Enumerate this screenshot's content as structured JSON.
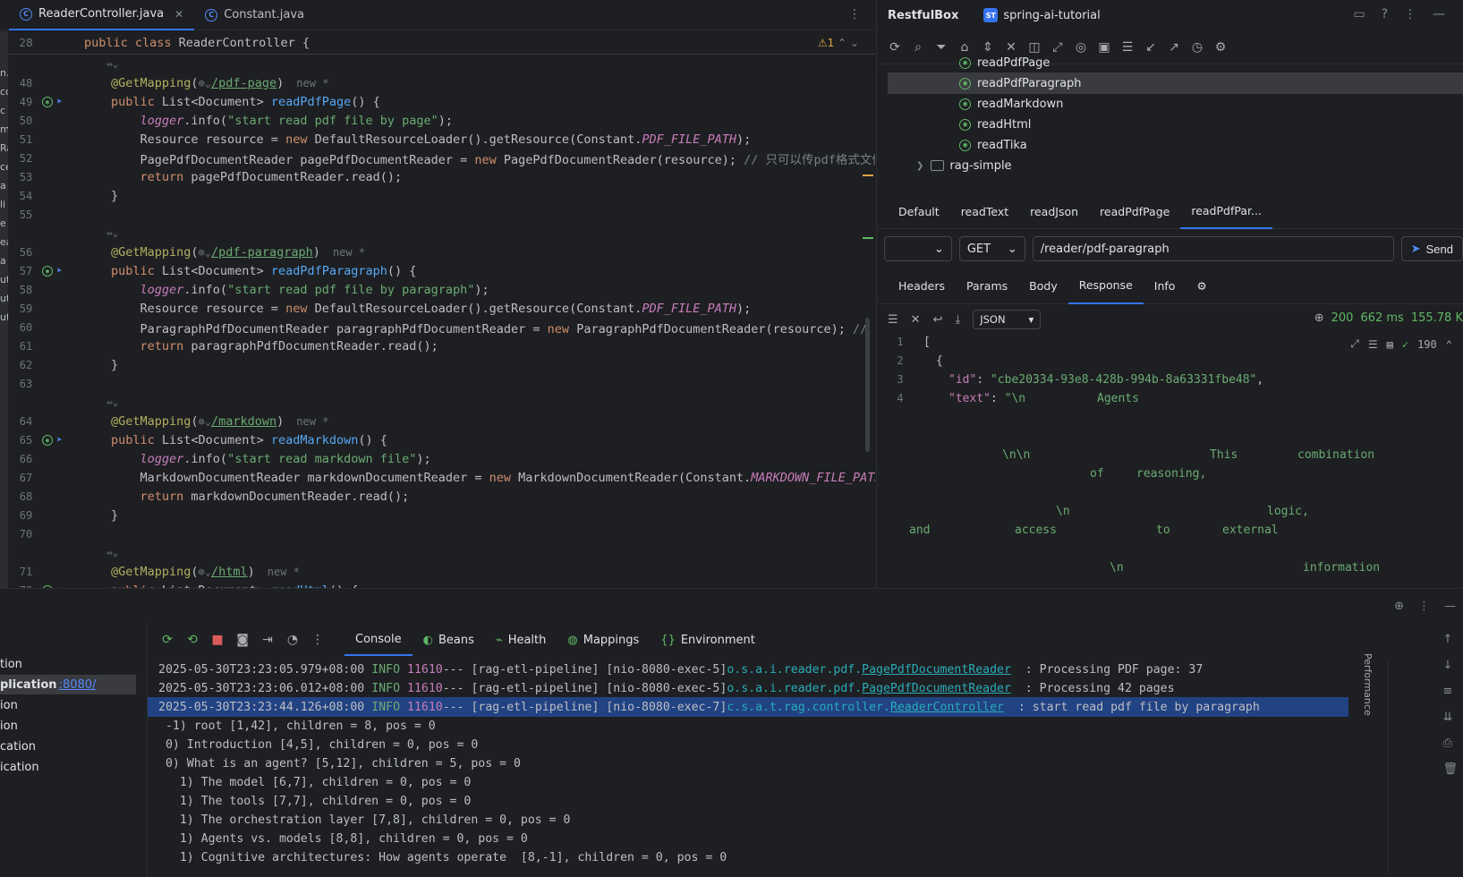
{
  "editor": {
    "tabs": [
      {
        "label": "ReaderController.java",
        "active": true
      },
      {
        "label": "Constant.java",
        "active": false
      }
    ],
    "sticky": {
      "line": "28",
      "text": "public class ReaderController {",
      "warnings": "⚠1"
    },
    "left_strip_chars": [
      "n.",
      "cc",
      "c",
      "m",
      "Ra",
      "ce",
      "a",
      "li",
      "e",
      "ea",
      "a",
      "ut",
      "ut",
      "ut"
    ],
    "lines": [
      {
        "n": "",
        "kind": "fold"
      },
      {
        "n": "48",
        "kind": "mapping",
        "path": "/pdf-page",
        "new": "new *"
      },
      {
        "n": "49",
        "kind": "sig",
        "name": "readPdfPage",
        "gutter": true
      },
      {
        "n": "50",
        "kind": "logger",
        "msg": "\"start read pdf file by page\""
      },
      {
        "n": "51",
        "kind": "resource",
        "const": "PDF_FILE_PATH"
      },
      {
        "n": "52",
        "kind": "page-reader",
        "comment": "// 只可以传pdf格式文件"
      },
      {
        "n": "53",
        "kind": "return",
        "var": "pagePdfDocumentReader"
      },
      {
        "n": "54",
        "kind": "close"
      },
      {
        "n": "55",
        "kind": "blank"
      },
      {
        "n": "",
        "kind": "fold"
      },
      {
        "n": "56",
        "kind": "mapping",
        "path": "/pdf-paragraph",
        "new": "new *"
      },
      {
        "n": "57",
        "kind": "sig",
        "name": "readPdfParagraph",
        "gutter": true
      },
      {
        "n": "58",
        "kind": "logger",
        "msg": "\"start read pdf file by paragraph\""
      },
      {
        "n": "59",
        "kind": "resource",
        "const": "PDF_FILE_PATH"
      },
      {
        "n": "60",
        "kind": "para-reader",
        "comment": "// 有目录"
      },
      {
        "n": "61",
        "kind": "return",
        "var": "paragraphPdfDocumentReader"
      },
      {
        "n": "62",
        "kind": "close"
      },
      {
        "n": "63",
        "kind": "blank"
      },
      {
        "n": "",
        "kind": "fold"
      },
      {
        "n": "64",
        "kind": "mapping",
        "path": "/markdown",
        "new": "new *"
      },
      {
        "n": "65",
        "kind": "sig",
        "name": "readMarkdown",
        "gutter": true
      },
      {
        "n": "66",
        "kind": "logger",
        "msg": "\"start read markdown file\""
      },
      {
        "n": "67",
        "kind": "md-reader",
        "const": "MARKDOWN_FILE_PATH"
      },
      {
        "n": "68",
        "kind": "return",
        "var": "markdownDocumentReader"
      },
      {
        "n": "69",
        "kind": "close"
      },
      {
        "n": "70",
        "kind": "blank"
      },
      {
        "n": "",
        "kind": "fold"
      },
      {
        "n": "71",
        "kind": "mapping",
        "path": "/html",
        "new": "new *"
      },
      {
        "n": "72",
        "kind": "sig",
        "name": "readHtml",
        "gutter": true
      }
    ]
  },
  "restfulbox": {
    "title": "RestfulBox",
    "project_badge": "ST",
    "project": "spring-ai-tutorial",
    "tree": [
      {
        "label": "readPdfPage",
        "selected": false
      },
      {
        "label": "readPdfParagraph",
        "selected": true
      },
      {
        "label": "readMarkdown",
        "selected": false
      },
      {
        "label": "readHtml",
        "selected": false
      },
      {
        "label": "readTika",
        "selected": false
      }
    ],
    "folder": "rag-simple",
    "request_tabs": [
      "Default",
      "readText",
      "readJson",
      "readPdfPage",
      "readPdfPar..."
    ],
    "active_request_tab": 4,
    "env_value": "",
    "method": "GET",
    "url": "/reader/pdf-paragraph",
    "send_label": "Send",
    "response_tabs": [
      "Headers",
      "Params",
      "Body",
      "Response",
      "Info"
    ],
    "active_response_tab": 3,
    "format": "JSON",
    "status_code": "200",
    "time": "662 ms",
    "size": "155.78 K",
    "count": "190",
    "json": {
      "l1": "[",
      "l2": "{",
      "id_key": "\"id\"",
      "id_val": "\"cbe20334-93e8-428b-994b-8a63331fbe48\"",
      "text_key": "\"text\"",
      "text_val": "\"\\n",
      "words": [
        "Agents",
        "\\n\\n",
        "This",
        "combination",
        "of",
        "reasoning,",
        "\\n",
        "logic,",
        "and",
        "access",
        "to",
        "external",
        "\\n",
        "information"
      ]
    }
  },
  "services": {
    "items": [
      {
        "label": "tion",
        "selected": false
      },
      {
        "label": "plication",
        "link": ":8080/",
        "selected": true
      },
      {
        "label": "ion",
        "selected": false
      },
      {
        "label": "ion",
        "selected": false
      },
      {
        "label": "cation",
        "selected": false
      },
      {
        "label": "ication",
        "selected": false
      }
    ],
    "console_tabs": [
      "Console",
      "Beans",
      "Health",
      "Mappings",
      "Environment"
    ],
    "active_console_tab": 0,
    "performance_label": "Performance",
    "logs": [
      {
        "ts": "2025-05-30T23:23:05.979+08:00",
        "level": "INFO",
        "pid": "11610",
        "thread": "--- [rag-etl-pipeline] [nio-8080-exec-5]",
        "pkg": "o.s.a.i.reader.pdf.",
        "cls": "PagePdfDocumentReader",
        "msg": "  : Processing PDF page: 37"
      },
      {
        "ts": "2025-05-30T23:23:06.012+08:00",
        "level": "INFO",
        "pid": "11610",
        "thread": "--- [rag-etl-pipeline] [nio-8080-exec-5]",
        "pkg": "o.s.a.i.reader.pdf.",
        "cls": "PagePdfDocumentReader",
        "msg": "  : Processing 42 pages"
      },
      {
        "ts": "2025-05-30T23:23:44.126+08:00",
        "level": "INFO",
        "pid": "11610",
        "thread": "--- [rag-etl-pipeline] [nio-8080-exec-7]",
        "pkg": "c.s.a.t.rag.controller.",
        "cls": "ReaderController",
        "msg": "  : start read pdf file by paragraph"
      }
    ],
    "tree_lines": [
      " -1) root [1,42], children = 8, pos = 0",
      " 0) Introduction [4,5], children = 0, pos = 0",
      " 0) What is an agent? [5,12], children = 5, pos = 0",
      "   1) The model [6,7], children = 0, pos = 0",
      "   1) The tools [7,7], children = 0, pos = 0",
      "   1) The orchestration layer [7,8], children = 0, pos = 0",
      "   1) Agents vs. models [8,8], children = 0, pos = 0",
      "   1) Cognitive architectures: How agents operate  [8,-1], children = 0, pos = 0"
    ]
  }
}
